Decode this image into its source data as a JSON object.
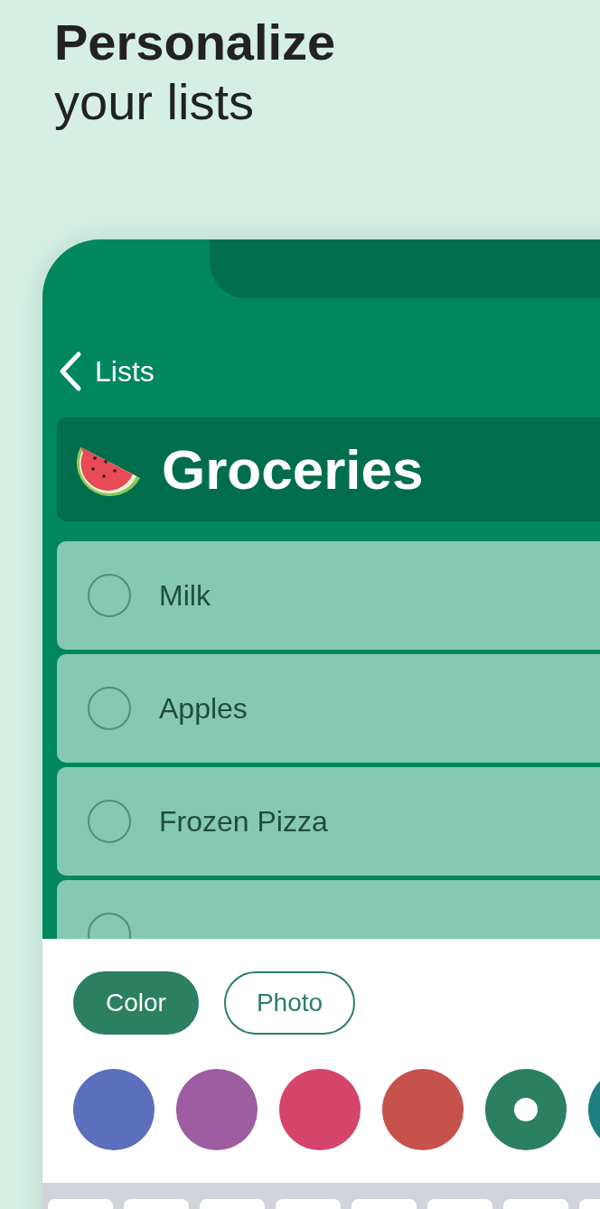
{
  "headline": {
    "title": "Personalize",
    "subtitle": "your lists"
  },
  "nav": {
    "back_label": "Lists"
  },
  "list_title": "Groceries",
  "items": [
    {
      "text": "Milk",
      "checked": false
    },
    {
      "text": "Apples",
      "checked": false
    },
    {
      "text": "Frozen Pizza",
      "checked": false
    },
    {
      "checked": false
    }
  ],
  "tabs": [
    {
      "label": "Color",
      "selected": true
    },
    {
      "label": "Photo",
      "selected": false
    }
  ],
  "swatches": [
    {
      "color": "#5b6fbd",
      "selected": false
    },
    {
      "color": "#9e5ca1",
      "selected": false
    },
    {
      "color": "#d4446b",
      "selected": false
    },
    {
      "color": "#c5524b",
      "selected": false
    },
    {
      "color": "#2a8060",
      "selected": true
    },
    {
      "color": "#1f7f80"
    }
  ]
}
